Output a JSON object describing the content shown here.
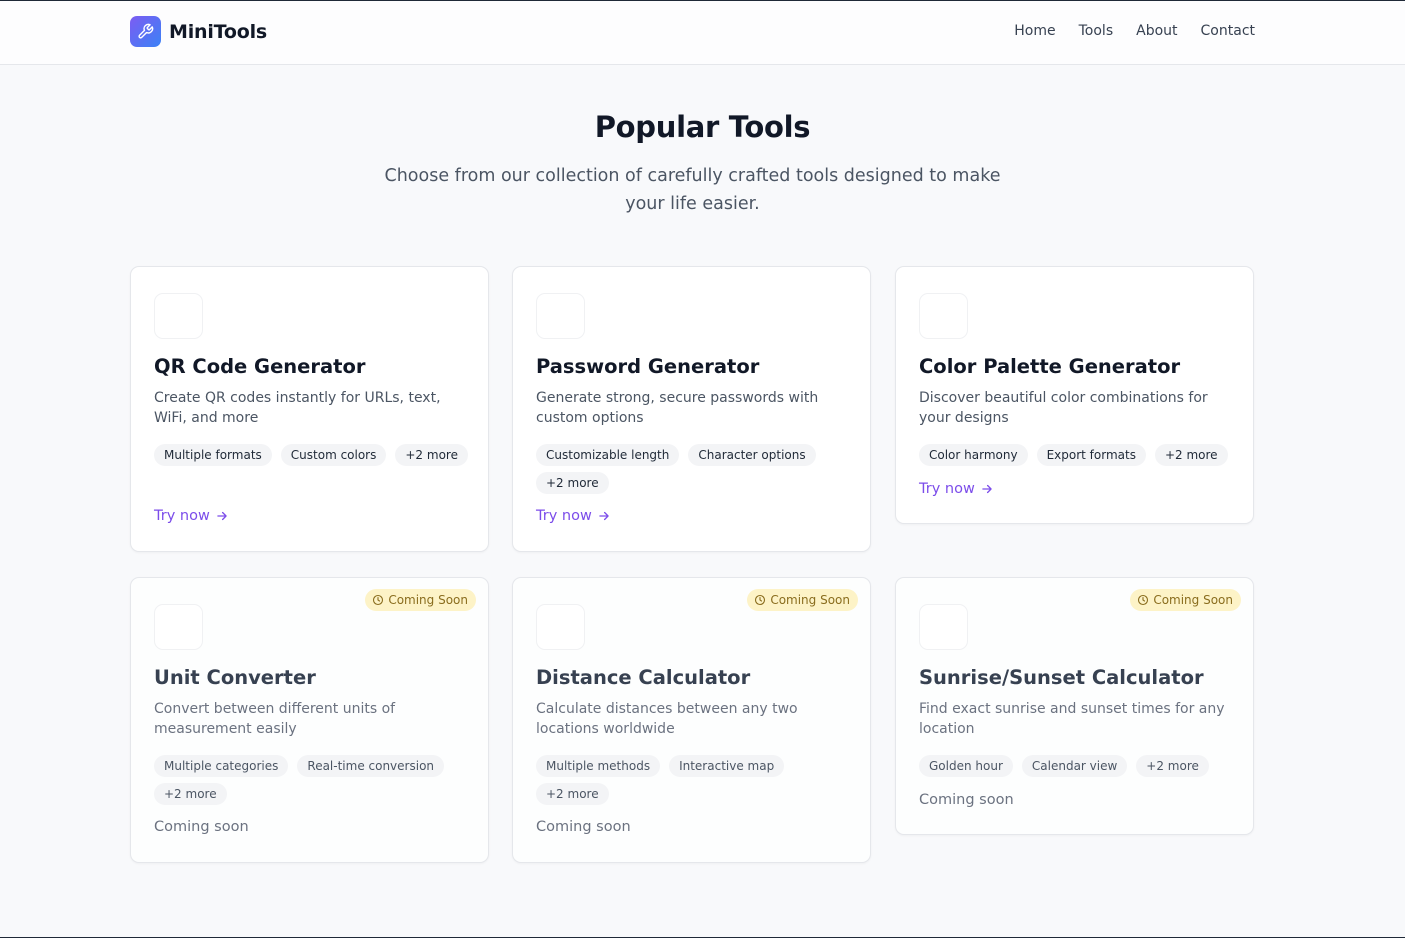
{
  "nav": {
    "brand": "MiniTools",
    "links": [
      "Home",
      "Tools",
      "About",
      "Contact"
    ]
  },
  "hero": {
    "title": "Popular Tools",
    "subtitle": "Choose from our collection of carefully crafted tools designed to make your life easier."
  },
  "tools": [
    {
      "title": "QR Code Generator",
      "description": "Create QR codes instantly for URLs, text, WiFi, and more",
      "tags": [
        "Multiple formats",
        "Custom colors",
        "+2 more"
      ],
      "action": "Try now"
    },
    {
      "title": "Password Generator",
      "description": "Generate strong, secure passwords with custom options",
      "tags": [
        "Customizable length",
        "Character options",
        "+2 more"
      ],
      "action": "Try now"
    },
    {
      "title": "Color Palette Generator",
      "description": "Discover beautiful color combinations for your designs",
      "tags": [
        "Color harmony",
        "Export formats",
        "+2 more"
      ],
      "action": "Try now"
    },
    {
      "title": "Unit Converter",
      "description": "Convert between different units of measurement easily",
      "tags": [
        "Multiple categories",
        "Real-time conversion",
        "+2 more"
      ],
      "badge": "Coming Soon",
      "status": "Coming soon"
    },
    {
      "title": "Distance Calculator",
      "description": "Calculate distances between any two locations worldwide",
      "tags": [
        "Multiple methods",
        "Interactive map",
        "+2 more"
      ],
      "badge": "Coming Soon",
      "status": "Coming soon"
    },
    {
      "title": "Sunrise/Sunset Calculator",
      "description": "Find exact sunrise and sunset times for any location",
      "tags": [
        "Golden hour",
        "Calendar view",
        "+2 more"
      ],
      "badge": "Coming Soon",
      "status": "Coming soon"
    }
  ],
  "colors": {
    "accent": "#7c4dea",
    "badge_bg": "#fdf3c7",
    "page_bg": "#f8f9fb"
  }
}
